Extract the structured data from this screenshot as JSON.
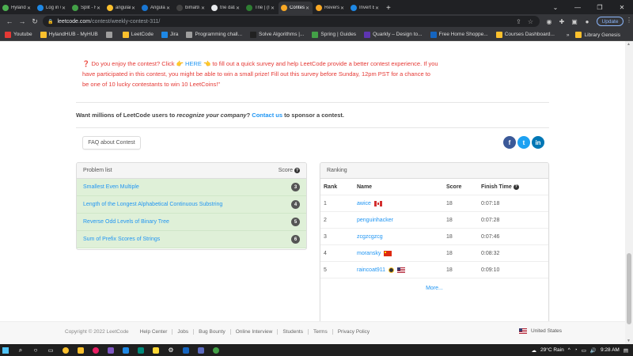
{
  "browser": {
    "tabs": [
      {
        "title": "Hyland Ic",
        "color": "#4caf50"
      },
      {
        "title": "Log in wi",
        "color": "#1e88e5"
      },
      {
        "title": "Split - Hy",
        "color": "#43a047"
      },
      {
        "title": "angular",
        "color": "#fbc02d"
      },
      {
        "title": "Angular",
        "color": "#1976d2"
      },
      {
        "title": "bimal97",
        "color": "#424242"
      },
      {
        "title": "trie data",
        "color": "#e8eaed"
      },
      {
        "title": "Trie | (Ins",
        "color": "#2e7d32"
      },
      {
        "title": "Contest",
        "color": "#f9a825",
        "active": true
      },
      {
        "title": "Reverse C",
        "color": "#f9a825"
      },
      {
        "title": "Invert Bi",
        "color": "#1e88e5"
      }
    ],
    "new_tab": "+",
    "url_host": "leetcode.com",
    "url_path": "/contest/weekly-contest-311/",
    "update_label": "Update",
    "bookmarks": [
      {
        "label": "Youtube",
        "color": "#e53935"
      },
      {
        "label": "HylandHUB - MyHUB",
        "color": "#fbc02d"
      },
      {
        "label": "",
        "color": "#9e9e9e"
      },
      {
        "label": "LeetCode",
        "color": "#fbc02d"
      },
      {
        "label": "Jira",
        "color": "#1e88e5"
      },
      {
        "label": "Programming chall...",
        "color": "#9e9e9e"
      },
      {
        "label": "Solve Algorithms |...",
        "color": "#212121"
      },
      {
        "label": "Spring | Guides",
        "color": "#43a047"
      },
      {
        "label": "Quarkly – Design to...",
        "color": "#5e35b1"
      },
      {
        "label": "Free Home Shoppe...",
        "color": "#1565c0"
      },
      {
        "label": "Courses Dashboard...",
        "color": "#fbc02d"
      }
    ],
    "bookmarks_right": "Library Genesis"
  },
  "survey": {
    "before_link": "Do you enjoy the contest? Click",
    "link": "HERE",
    "after_link": "to fill out a quick survey and help LeetCode provide a better contest experience. If you have participated in this contest, you might be able to win a small prize! Fill out this survey before Sunday, 12pm PST for a chance to be one of 10 lucky contestants to win 10 LeetCoins!\""
  },
  "sponsor": {
    "before": "Want millions of LeetCode users to",
    "emphasis": "recognize your company",
    "mid": "?",
    "link": "Contact us",
    "after": "to sponsor a contest."
  },
  "faq_label": "FAQ about Contest",
  "socials": [
    {
      "label": "f",
      "color": "#3b5998"
    },
    {
      "label": "t",
      "color": "#1da1f2"
    },
    {
      "label": "in",
      "color": "#0077b5"
    }
  ],
  "problems": {
    "title": "Problem list",
    "score_header": "Score",
    "items": [
      {
        "title": "Smallest Even Multiple",
        "score": "3"
      },
      {
        "title": "Length of the Longest Alphabetical Continuous Substring",
        "score": "4"
      },
      {
        "title": "Reverse Odd Levels of Binary Tree",
        "score": "5"
      },
      {
        "title": "Sum of Prefix Scores of Strings",
        "score": "6"
      }
    ]
  },
  "ranking": {
    "title": "Ranking",
    "headers": {
      "rank": "Rank",
      "name": "Name",
      "score": "Score",
      "time": "Finish Time"
    },
    "rows": [
      {
        "rank": "1",
        "name": "awice",
        "score": "18",
        "time": "0:07:18",
        "flag": "ca"
      },
      {
        "rank": "2",
        "name": "penguinhacker",
        "score": "18",
        "time": "0:07:28",
        "flag": ""
      },
      {
        "rank": "3",
        "name": "zcgzcgzcg",
        "score": "18",
        "time": "0:07:46",
        "flag": ""
      },
      {
        "rank": "4",
        "name": "moransky",
        "score": "18",
        "time": "0:08:32",
        "flag": "cn"
      },
      {
        "rank": "5",
        "name": "raincoat911",
        "score": "18",
        "time": "0:09:10",
        "flag": "us"
      }
    ],
    "more": "More..."
  },
  "footer": {
    "copyright": "Copyright © 2022 LeetCode",
    "links": [
      "Help Center",
      "Jobs",
      "Bug Bounty",
      "Online Interview",
      "Students",
      "Terms",
      "Privacy Policy"
    ],
    "region": "United States"
  },
  "taskbar": {
    "weather": "29°C Rain",
    "time": "9:28 AM"
  },
  "colors": {
    "accent_link": "#2196f3",
    "survey_red": "#e53935",
    "problem_row_bg": "#dff0d8"
  }
}
